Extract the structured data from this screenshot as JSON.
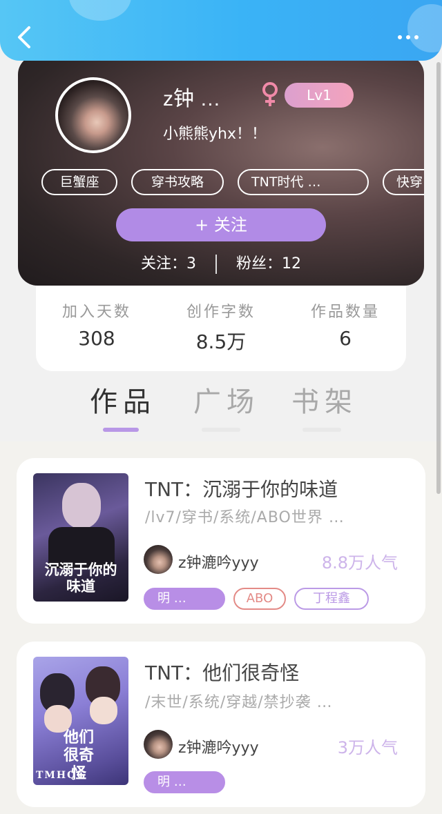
{
  "header": {
    "back_icon": "chevron-left-icon",
    "more_icon": "more-dots-icon"
  },
  "profile": {
    "username": "z钟 …",
    "gender_icon": "female-icon",
    "level": "Lv1",
    "signature": "小熊熊yhx！！",
    "tags": [
      "巨蟹座",
      "穿书攻略",
      "TNT时代 …",
      "快穿"
    ],
    "follow_label": "+ 关注",
    "following_label": "关注：3",
    "fans_label": "粉丝：12"
  },
  "stats": [
    {
      "label": "加入天数",
      "value": "308"
    },
    {
      "label": "创作字数",
      "value": "8.5万"
    },
    {
      "label": "作品数量",
      "value": "6"
    }
  ],
  "tabs": [
    {
      "label": "作品",
      "active": true
    },
    {
      "label": "广场",
      "active": false
    },
    {
      "label": "书架",
      "active": false
    }
  ],
  "books": [
    {
      "title": "TNT：沉溺于你的味道",
      "description": "/lv7/穿书/系统/ABO世界 …",
      "cover_text": "沉溺于你的味道",
      "author": "z钟漉吟yyy",
      "popularity": "8.8万人气",
      "tags": [
        "明 …",
        "ABO",
        "丁程鑫"
      ]
    },
    {
      "title": "TNT：他们很奇怪",
      "description": "/末世/系统/穿越/禁抄袭 …",
      "cover_text": "他们很奇怪",
      "cover_subtext": "TMHQG",
      "author": "z钟漉吟yyy",
      "popularity": "3万人气",
      "tags": [
        "明 …"
      ]
    }
  ],
  "colors": {
    "header": "#3ab3f6",
    "accent": "#b18be6",
    "level_badge": "#f3a3bd"
  }
}
